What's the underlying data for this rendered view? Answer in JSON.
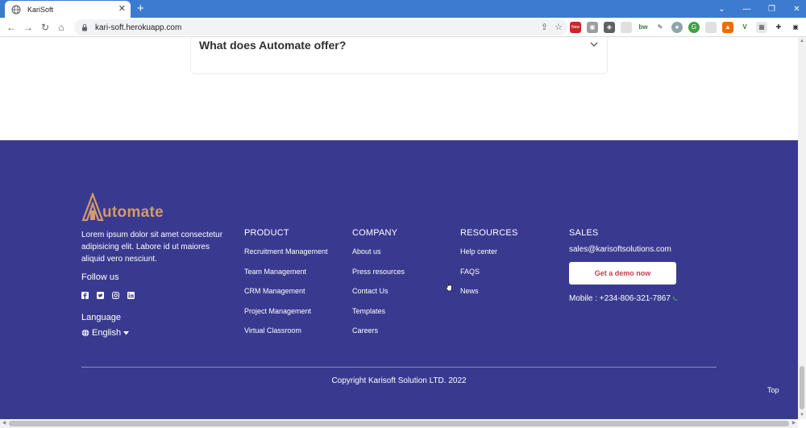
{
  "browser": {
    "tab_title": "KariSoft",
    "new_tab": "+",
    "url": "kari-soft.herokuapp.com",
    "extension_badge_new": "New",
    "extension_bw": "bw"
  },
  "faq": {
    "question": "What does Automate offer?"
  },
  "footer": {
    "logo_text": "utomate",
    "about": "Lorem ipsum dolor sit amet consectetur adipisicing elit. Labore id ut maiores aliquid vero nesciunt.",
    "follow_label": "Follow us",
    "language_label": "Language",
    "language_value": "English",
    "product": {
      "heading": "PRODUCT",
      "links": [
        "Recruitment Management",
        "Team Management",
        "CRM Management",
        "Project Management",
        "Virtual Classroom"
      ]
    },
    "company": {
      "heading": "COMPANY",
      "links": [
        "About us",
        "Press resources",
        "Contact Us",
        "Templates",
        "Careers"
      ]
    },
    "resources": {
      "heading": "RESOURCES",
      "links": [
        "Help center",
        "FAQS",
        "News"
      ]
    },
    "sales": {
      "heading": "SALES",
      "email": "sales@karisoftsolutions.com",
      "demo_button": "Get a demo now",
      "mobile": "Mobile : +234-806-321-7867"
    },
    "copyright": "Copyright Karisoft Solution LTD. 2022",
    "top_link": "Top"
  },
  "colors": {
    "footer_bg": "#393a8f",
    "logo": "#d39a6a",
    "demo_text": "#c93a50",
    "chrome_tabbar": "#3d7bd1"
  }
}
